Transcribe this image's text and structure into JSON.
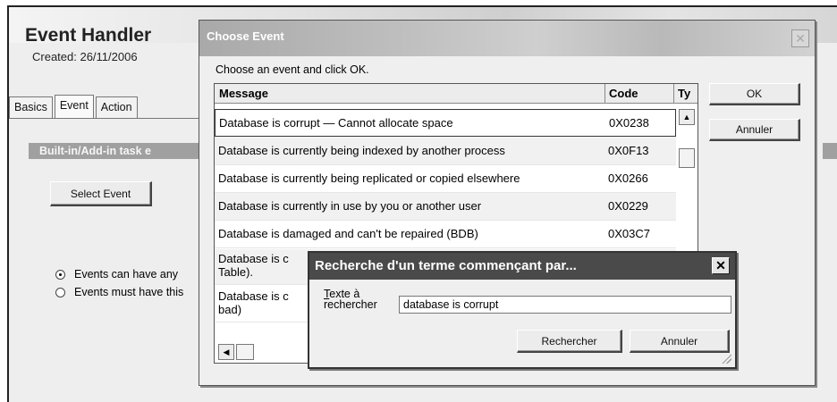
{
  "app": {
    "title": "Event Handler",
    "created": "Created: 26/11/2006",
    "tabs": [
      "Basics",
      "Event",
      "Action"
    ],
    "section_label": "Built-in/Add-in task e",
    "select_event_label": "Select Event",
    "radio_1": "Events can have any",
    "radio_2": "Events must have this"
  },
  "choose_dialog": {
    "title": "Choose Event",
    "close_glyph": "✕",
    "instruction": "Choose an event and click OK.",
    "columns": {
      "message": "Message",
      "code": "Code",
      "type": "Ty"
    },
    "rows": [
      {
        "message": "Database is corrupt — Cannot allocate space",
        "code": "0X0238"
      },
      {
        "message": "Database is currently being indexed by another process",
        "code": "0X0F13"
      },
      {
        "message": "Database is currently being replicated or copied elsewhere",
        "code": "0X0266"
      },
      {
        "message": "Database is currently in use by you or another user",
        "code": "0X0229"
      },
      {
        "message": "Database is damaged and can't be repaired (BDB)",
        "code": "0X03C7"
      },
      {
        "message": "Database is c",
        "message_line2": "Table).",
        "code": ""
      },
      {
        "message": "Database is c",
        "message_line2": "bad)",
        "code": ""
      }
    ],
    "ok_label": "OK",
    "cancel_label": "Annuler"
  },
  "find_dialog": {
    "title": "Recherche d'un terme commençant par...",
    "close_glyph": "✕",
    "label_underlined": "T",
    "label_rest": "exte à",
    "label_line2": "rechercher",
    "input_value": "database is corrupt",
    "search_label": "Rechercher",
    "cancel_label": "Annuler"
  }
}
